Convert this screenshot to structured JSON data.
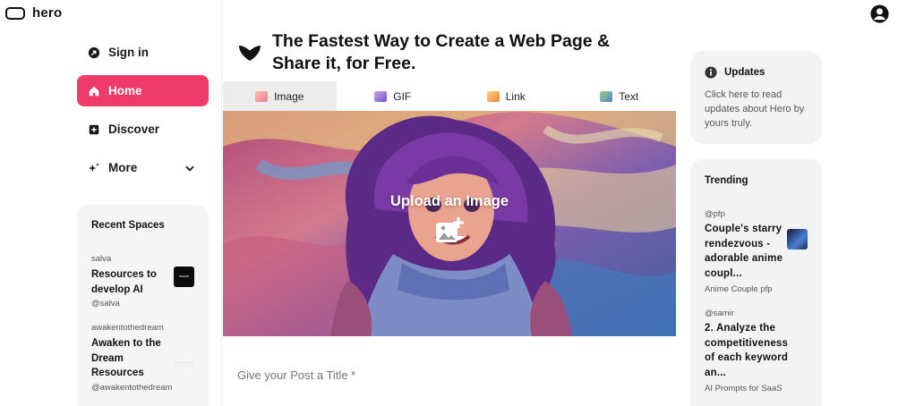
{
  "app": {
    "name": "hero"
  },
  "nav": {
    "sign_in": "Sign in",
    "home": "Home",
    "discover": "Discover",
    "more": "More"
  },
  "recent": {
    "heading": "Recent Spaces",
    "items": [
      {
        "owner": "salva",
        "title": "Resources to develop AI",
        "handle": "@salva"
      },
      {
        "owner": "awakentothedream",
        "title": "Awaken to the Dream Resources",
        "handle": "@awakentothedream"
      }
    ]
  },
  "headline": "The Fastest Way to Create a Web Page & Share it, for Free.",
  "tabs": [
    {
      "label": "Image",
      "icon": "image-icon",
      "color": "#f07aa0"
    },
    {
      "label": "GIF",
      "icon": "gif-icon",
      "color": "#9a6bd6"
    },
    {
      "label": "Link",
      "icon": "link-icon",
      "color": "#f4a24a"
    },
    {
      "label": "Text",
      "icon": "text-icon",
      "color": "#5a9bd6"
    }
  ],
  "upload": {
    "label": "Upload an Image"
  },
  "post": {
    "placeholder": "Give your Post a Title *"
  },
  "updates": {
    "heading": "Updates",
    "body": "Click here to read updates about Hero by yours truly."
  },
  "trending": {
    "heading": "Trending",
    "items": [
      {
        "owner": "@pfp",
        "title": "Couple's starry rendezvous - adorable anime coupl...",
        "sub": "Anime Couple pfp"
      },
      {
        "owner": "@samir",
        "title": "2. Analyze the competitiveness of each keyword an...",
        "sub": "AI Prompts for SaaS"
      }
    ]
  },
  "colors": {
    "accent": "#ef3b6a"
  }
}
